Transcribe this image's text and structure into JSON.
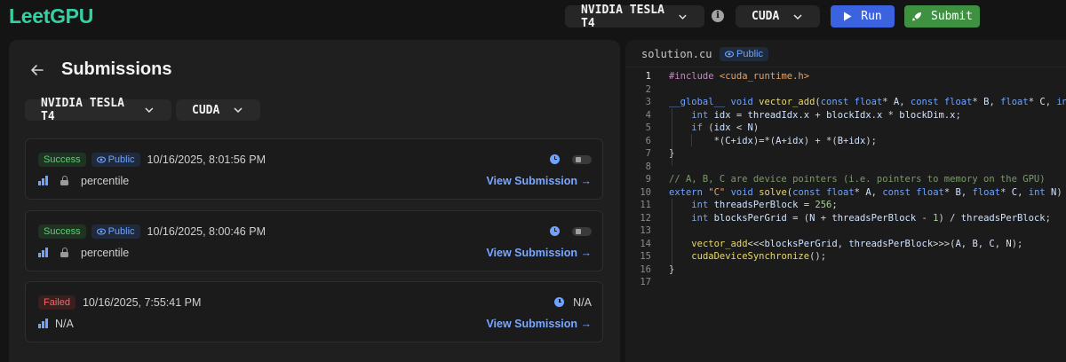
{
  "brand": {
    "logo": "LeetGPU"
  },
  "toolbar": {
    "gpu": "NVIDIA TESLA T4",
    "language": "CUDA",
    "run_label": "Run",
    "submit_label": "Submit",
    "run_color": "#3b63e0",
    "submit_color": "#3f9142"
  },
  "submissions_panel": {
    "title": "Submissions",
    "filters": {
      "gpu": "NVIDIA TESLA T4",
      "language": "CUDA"
    },
    "items": [
      {
        "status": "Success",
        "visibility": "Public",
        "timestamp": "10/16/2025, 8:01:56 PM",
        "runtime": "",
        "percentile_label": "percentile",
        "link": "View Submission →"
      },
      {
        "status": "Success",
        "visibility": "Public",
        "timestamp": "10/16/2025, 8:00:46 PM",
        "runtime": "",
        "percentile_label": "percentile",
        "link": "View Submission →"
      },
      {
        "status": "Failed",
        "timestamp": "10/16/2025, 7:55:41 PM",
        "runtime": "N/A",
        "percentile_label": "N/A",
        "link": "View Submission →"
      }
    ]
  },
  "editor": {
    "filename": "solution.cu",
    "visibility": "Public",
    "current_line": 1,
    "lines": [
      "#include <cuda_runtime.h>",
      "",
      "__global__ void vector_add(const float* A, const float* B, float* C, int N) {",
      "    int idx = threadIdx.x + blockIdx.x * blockDim.x;",
      "    if (idx < N)",
      "        *(C+idx)=*(A+idx) + *(B+idx);",
      "}",
      "",
      "// A, B, C are device pointers (i.e. pointers to memory on the GPU)",
      "extern \"C\" void solve(const float* A, const float* B, float* C, int N) {",
      "    int threadsPerBlock = 256;",
      "    int blocksPerGrid = (N + threadsPerBlock - 1) / threadsPerBlock;",
      "",
      "    vector_add<<<blocksPerGrid, threadsPerBlock>>>(A, B, C, N);",
      "    cudaDeviceSynchronize();",
      "}",
      ""
    ]
  },
  "icons": [
    "info-icon",
    "play-icon",
    "rocket-icon",
    "back-arrow-icon",
    "chevron-down-icon",
    "eye-icon",
    "clock-icon",
    "bar-chart-icon",
    "lock-icon"
  ]
}
